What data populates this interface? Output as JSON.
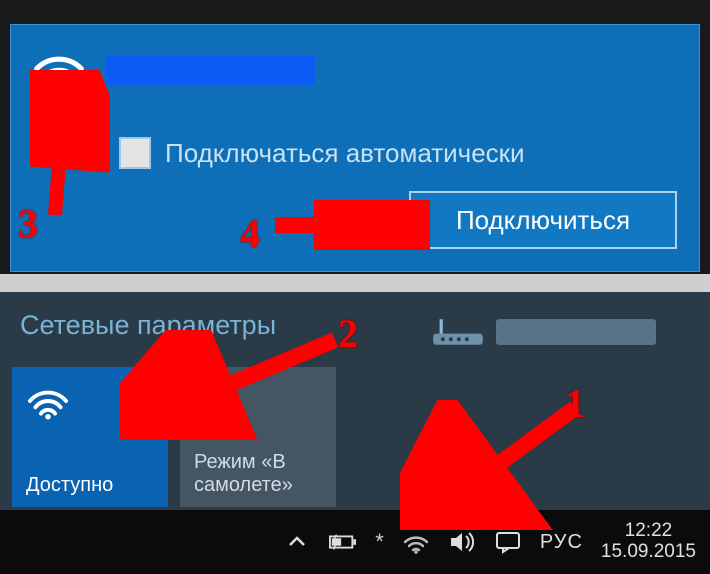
{
  "top": {
    "auto_label": "Подключаться автоматически",
    "connect": "Подключиться"
  },
  "bottom": {
    "settings": "Сетевые параметры",
    "wifi_tile": "Доступно",
    "air_tile": "Режим «В самолете»"
  },
  "taskbar": {
    "lang": "РУС",
    "time": "12:22",
    "date": "15.09.2015"
  },
  "annotations": {
    "n1": "1",
    "n2": "2",
    "n3": "3",
    "n4": "4"
  }
}
